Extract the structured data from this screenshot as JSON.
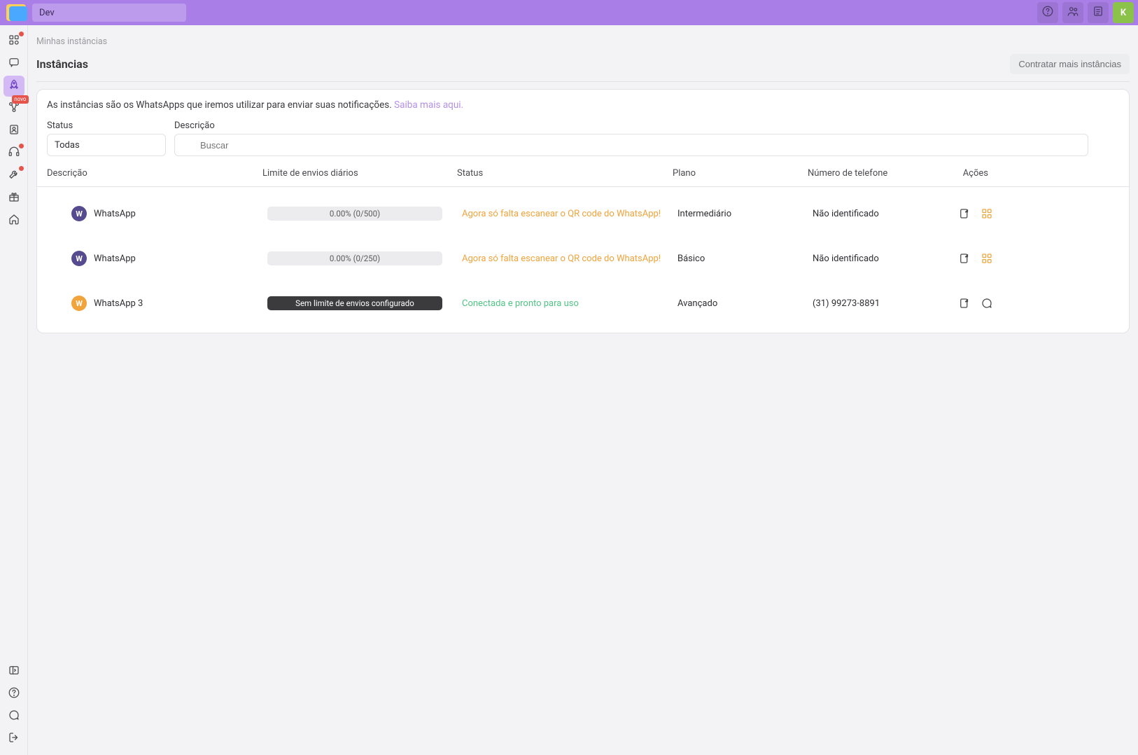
{
  "topbar": {
    "project_name": "Dev",
    "user_initial": "K"
  },
  "sidebar": {
    "items": [
      {
        "name": "dashboard",
        "has_dot": true
      },
      {
        "name": "chat",
        "has_dot": false
      },
      {
        "name": "rocket",
        "has_dot": false,
        "active": true
      },
      {
        "name": "flow",
        "has_dot": false,
        "badge": "novo"
      },
      {
        "name": "contacts",
        "has_dot": false
      },
      {
        "name": "support",
        "has_dot": true
      },
      {
        "name": "tools",
        "has_dot": true
      },
      {
        "name": "gift",
        "has_dot": false
      },
      {
        "name": "home",
        "has_dot": false
      }
    ],
    "bottom_items": [
      {
        "name": "panel"
      },
      {
        "name": "help"
      },
      {
        "name": "bubble"
      },
      {
        "name": "logout"
      }
    ]
  },
  "breadcrumb": "Minhas instâncias",
  "page_title": "Instâncias",
  "hire_button": "Contratar mais instâncias",
  "info_text": "As instâncias são os WhatsApps que iremos utilizar para enviar suas notificações. ",
  "info_link": "Saiba mais aqui.",
  "filters": {
    "status_label": "Status",
    "status_value": "Todas",
    "description_label": "Descrição",
    "search_placeholder": "Buscar"
  },
  "columns": {
    "description": "Descrição",
    "limit": "Limite de envios diários",
    "status": "Status",
    "plan": "Plano",
    "phone": "Número de telefone",
    "actions": "Ações"
  },
  "rows": [
    {
      "badge_color": "purple",
      "badge_letter": "W",
      "name": "WhatsApp",
      "limit_type": "bar",
      "limit_text": "0.00% (0/500)",
      "status_type": "warn",
      "status_text": "Agora só falta escanear o QR code do WhatsApp!",
      "plan": "Intermediário",
      "phone": "Não identificado",
      "action2": "qr"
    },
    {
      "badge_color": "purple",
      "badge_letter": "W",
      "name": "WhatsApp",
      "limit_type": "bar",
      "limit_text": "0.00% (0/250)",
      "status_type": "warn",
      "status_text": "Agora só falta escanear o QR code do WhatsApp!",
      "plan": "Básico",
      "phone": "Não identificado",
      "action2": "qr"
    },
    {
      "badge_color": "orange",
      "badge_letter": "W",
      "name": "WhatsApp 3",
      "limit_type": "pill",
      "limit_text": "Sem limite de envios configurado",
      "status_type": "ok",
      "status_text": "Conectada e pronto para uso",
      "plan": "Avançado",
      "phone": "(31) 99273-8891",
      "action2": "chat"
    }
  ]
}
